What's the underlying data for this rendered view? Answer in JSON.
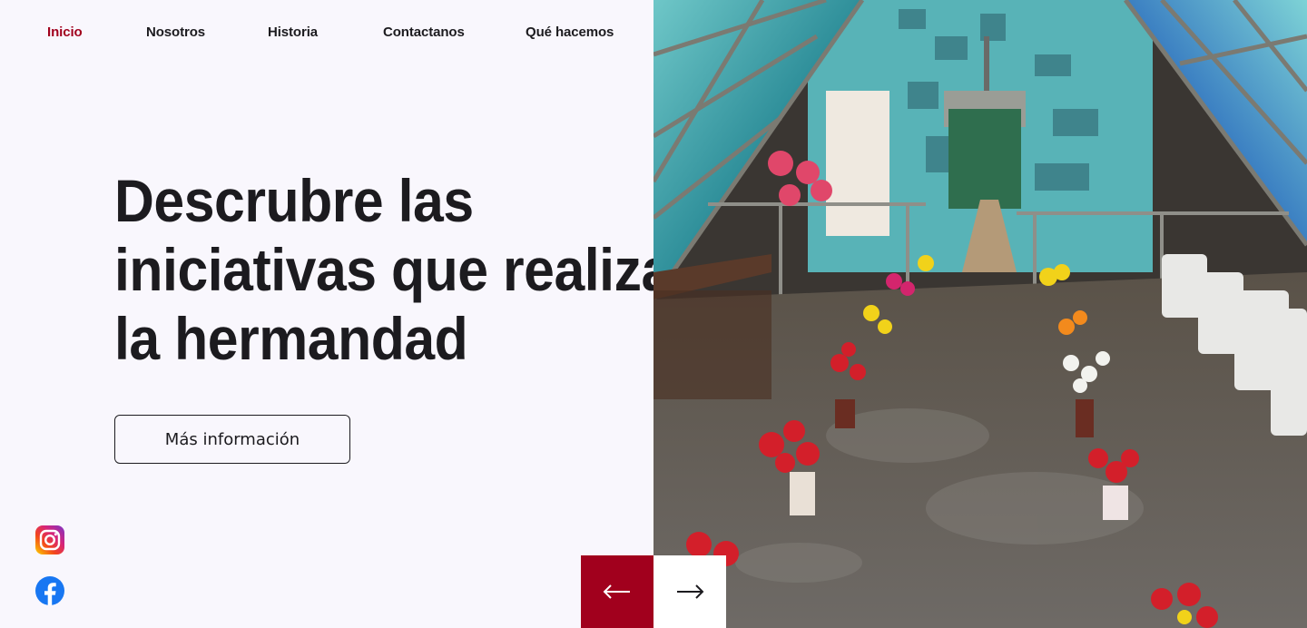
{
  "nav": {
    "items": [
      {
        "label": "Inicio",
        "active": true
      },
      {
        "label": "Nosotros",
        "active": false
      },
      {
        "label": "Historia",
        "active": false
      },
      {
        "label": "Contactanos",
        "active": false
      },
      {
        "label": "Qué hacemos",
        "active": false
      }
    ]
  },
  "hero": {
    "title_lines": [
      "Descrubre las",
      "iniciativas que realiza",
      "la hermandad"
    ],
    "button_label": "Más información"
  },
  "social": {
    "instagram_icon": "instagram-icon",
    "facebook_icon": "facebook-icon"
  },
  "slider": {
    "prev_icon": "arrow-left-icon",
    "next_icon": "arrow-right-icon"
  },
  "colors": {
    "accent": "#a1001d",
    "background": "#f9f7fd",
    "text": "#1c1b1f"
  }
}
